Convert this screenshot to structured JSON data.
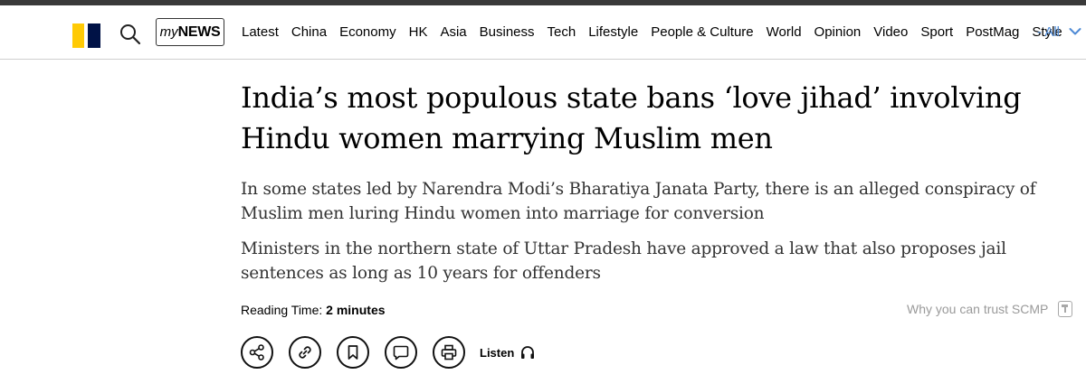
{
  "header": {
    "logo": {
      "name": "scmp-logo",
      "colors": {
        "yellow": "#FFCA05",
        "navy": "#001246"
      }
    },
    "search_icon": "search-icon",
    "mynews": {
      "my": "my",
      "news": "NEWS"
    },
    "nav_items": [
      "Latest",
      "China",
      "Economy",
      "HK",
      "Asia",
      "Business",
      "Tech",
      "Lifestyle",
      "People & Culture",
      "World",
      "Opinion",
      "Video",
      "Sport",
      "PostMag",
      "Style"
    ],
    "nav_all_label": "- All",
    "nav_all_color": "#4e8ad5"
  },
  "article": {
    "headline": "India’s most populous state bans ‘love jihad’ involving Hindu women marrying Muslim men",
    "summary_1": "In some states led by Narendra Modi’s Bharatiya Janata Party, there is an alleged conspiracy of Muslim men luring Hindu women into marriage for conversion",
    "summary_2": "Ministers in the northern state of Uttar Pradesh have approved a law that also proposes jail sentences as long as 10 years for offenders",
    "reading_time_label": "Reading Time:",
    "reading_time_value": "2 minutes",
    "trust_label": "Why you can trust SCMP"
  },
  "actions": {
    "icons": [
      "share-icon",
      "link-icon",
      "bookmark-icon",
      "comment-icon",
      "print-icon"
    ],
    "listen_label": "Listen"
  }
}
